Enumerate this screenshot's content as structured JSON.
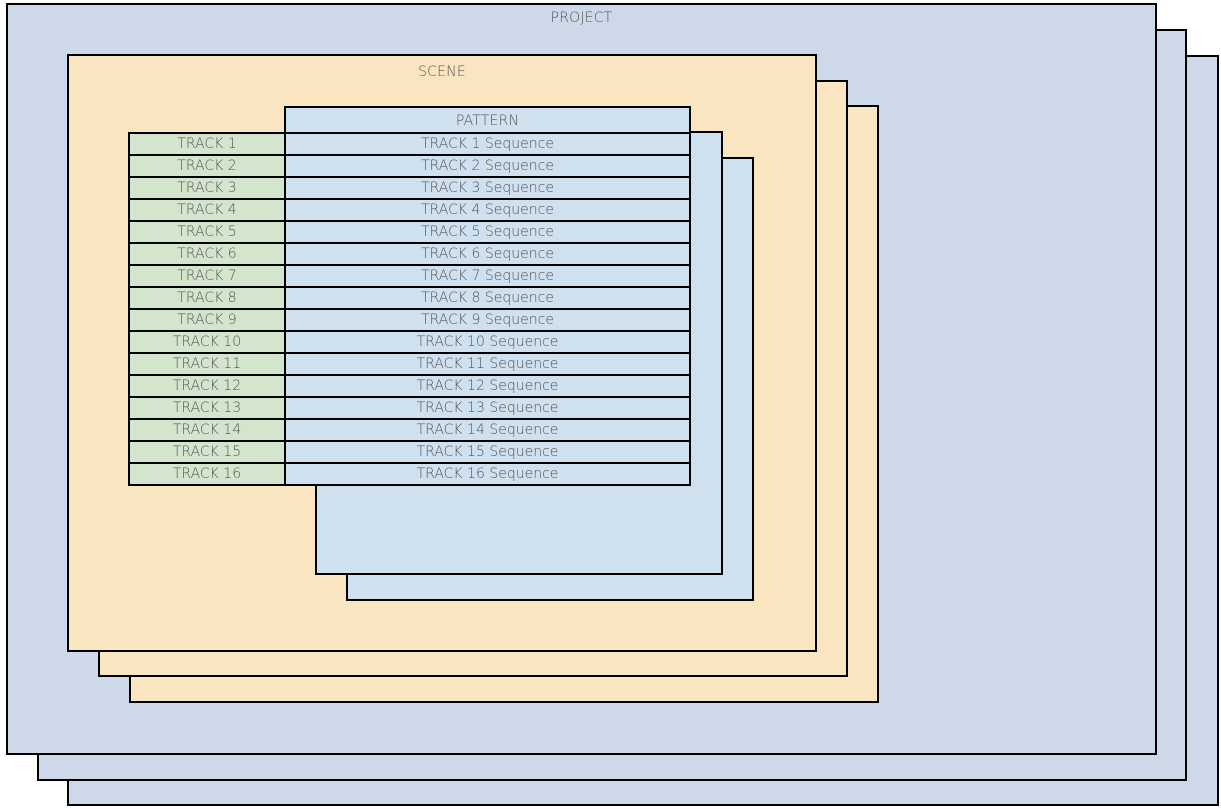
{
  "project": {
    "title": "PROJECT"
  },
  "scene": {
    "title": "SCENE"
  },
  "pattern": {
    "title": "PATTERN"
  },
  "tracks": [
    {
      "name": "TRACK 1",
      "sequence": "TRACK 1 Sequence"
    },
    {
      "name": "TRACK 2",
      "sequence": "TRACK 2 Sequence"
    },
    {
      "name": "TRACK 3",
      "sequence": "TRACK 3 Sequence"
    },
    {
      "name": "TRACK 4",
      "sequence": "TRACK 4 Sequence"
    },
    {
      "name": "TRACK 5",
      "sequence": "TRACK 5 Sequence"
    },
    {
      "name": "TRACK 6",
      "sequence": "TRACK 6 Sequence"
    },
    {
      "name": "TRACK 7",
      "sequence": "TRACK 7 Sequence"
    },
    {
      "name": "TRACK 8",
      "sequence": "TRACK 8 Sequence"
    },
    {
      "name": "TRACK 9",
      "sequence": "TRACK 9 Sequence"
    },
    {
      "name": "TRACK 10",
      "sequence": "TRACK 10 Sequence"
    },
    {
      "name": "TRACK 11",
      "sequence": "TRACK 11 Sequence"
    },
    {
      "name": "TRACK 12",
      "sequence": "TRACK 12 Sequence"
    },
    {
      "name": "TRACK 13",
      "sequence": "TRACK 13 Sequence"
    },
    {
      "name": "TRACK 14",
      "sequence": "TRACK 14 Sequence"
    },
    {
      "name": "TRACK 15",
      "sequence": "TRACK 15 Sequence"
    },
    {
      "name": "TRACK 16",
      "sequence": "TRACK 16 Sequence"
    }
  ]
}
